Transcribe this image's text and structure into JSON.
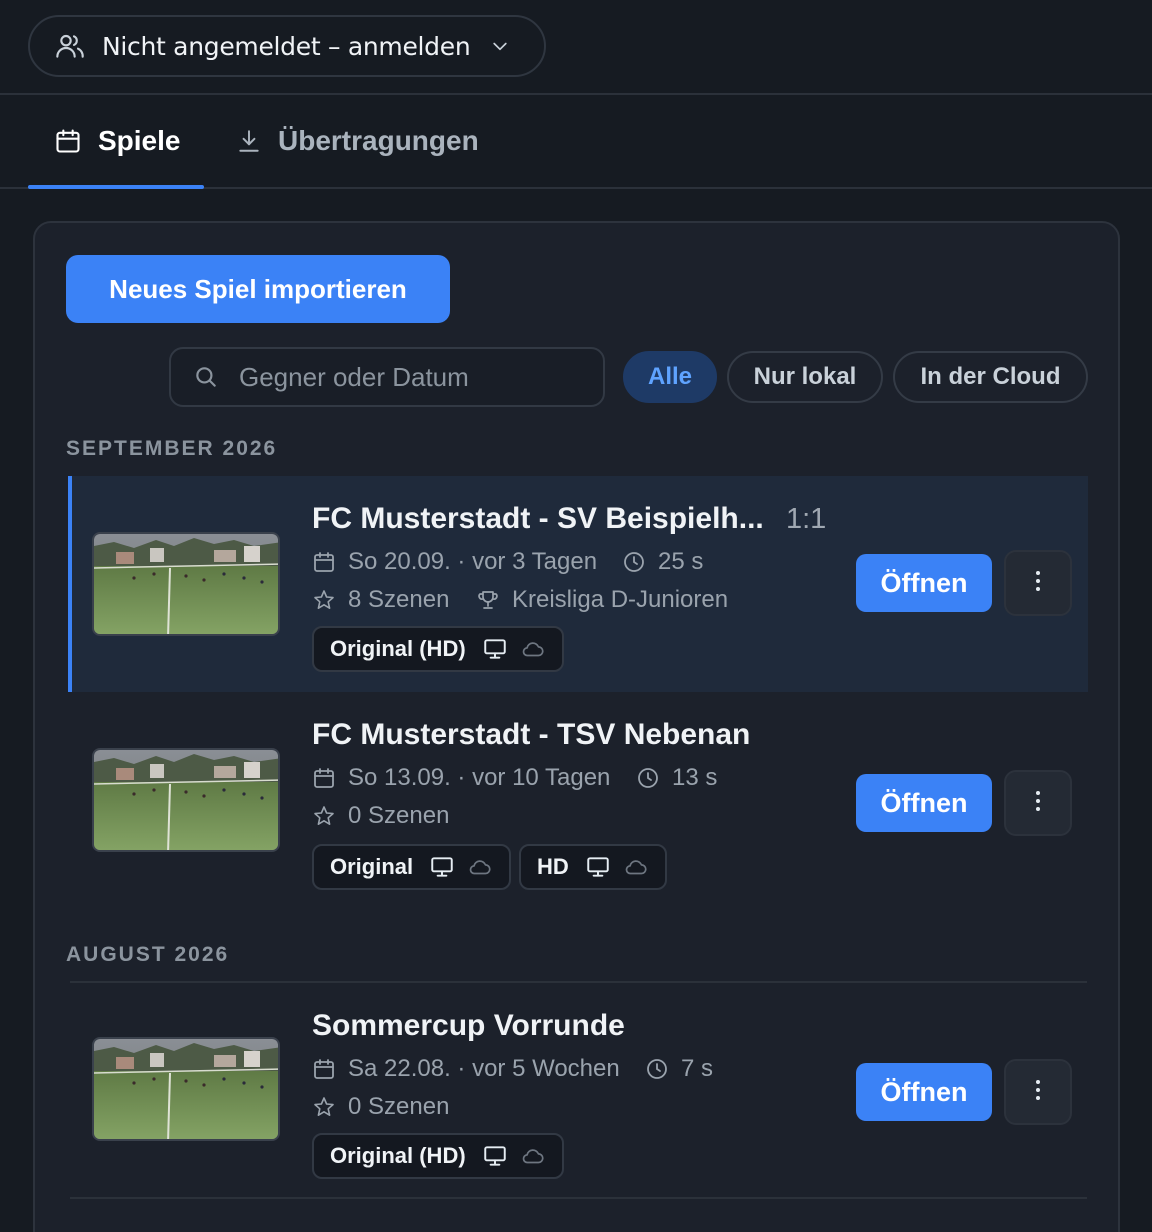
{
  "account": {
    "label": "Nicht angemeldet – anmelden",
    "icon": "users-icon"
  },
  "tabs": [
    {
      "label": "Spiele",
      "icon": "calendar-icon",
      "active": true
    },
    {
      "label": "Übertragungen",
      "icon": "download-icon",
      "active": false
    }
  ],
  "toolbar": {
    "import_label": "Neues Spiel importieren"
  },
  "search": {
    "placeholder": "Gegner oder Datum"
  },
  "filters": [
    {
      "label": "Alle",
      "active": true
    },
    {
      "label": "Nur lokal",
      "active": false
    },
    {
      "label": "In der Cloud",
      "active": false
    }
  ],
  "colors": {
    "accent": "#3b82f6",
    "background": "#161b22",
    "panel": "#1c212b",
    "selected_row": "#1f2a3b"
  },
  "groups": [
    {
      "month": "SEPTEMBER 2026",
      "games": [
        {
          "title": "FC Musterstadt - SV Beispielh...",
          "score": "1:1",
          "date": "So 20.09. · vor 3 Tagen",
          "duration": "25 s",
          "scenes": "8 Szenen",
          "league": "Kreisliga D-Junioren",
          "open_label": "Öffnen",
          "selected": true,
          "versions": [
            {
              "label": "Original (HD)"
            }
          ]
        },
        {
          "title": "FC Musterstadt - TSV Nebenan",
          "score": "",
          "date": "So 13.09. · vor 10 Tagen",
          "duration": "13 s",
          "scenes": "0 Szenen",
          "open_label": "Öffnen",
          "selected": false,
          "versions": [
            {
              "label": "Original"
            },
            {
              "label": "HD"
            }
          ]
        }
      ]
    },
    {
      "month": "AUGUST 2026",
      "games": [
        {
          "title": "Sommercup Vorrunde",
          "score": "",
          "date": "Sa 22.08. · vor 5 Wochen",
          "duration": "7 s",
          "scenes": "0 Szenen",
          "open_label": "Öffnen",
          "selected": false,
          "versions": [
            {
              "label": "Original (HD)"
            }
          ]
        }
      ]
    }
  ]
}
